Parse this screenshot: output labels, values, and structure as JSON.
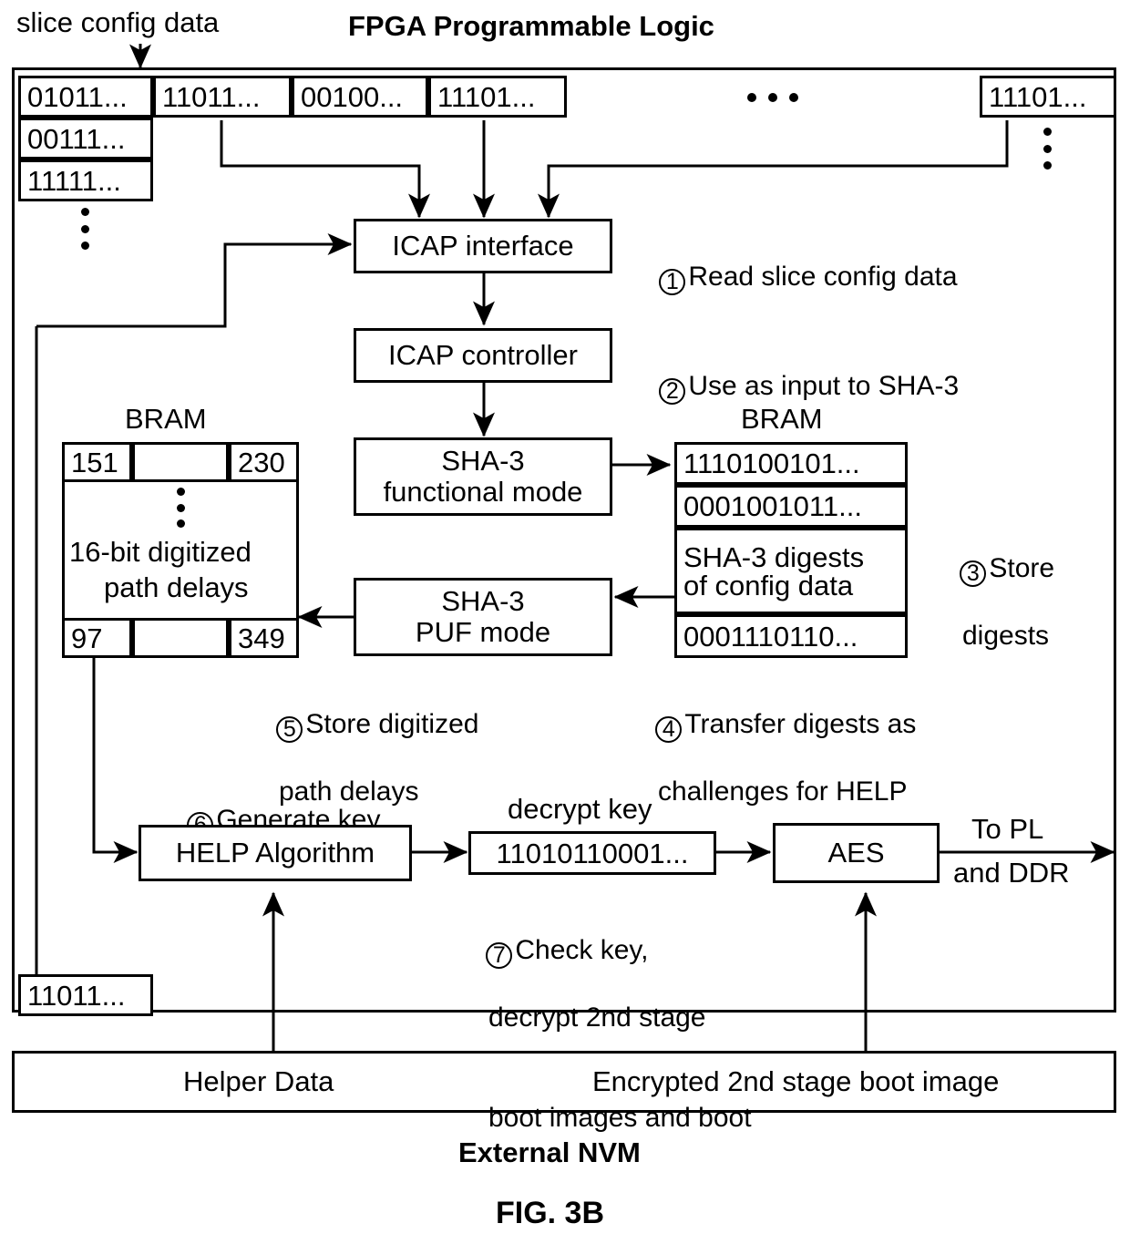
{
  "figure": {
    "caption": "FIG. 3B",
    "top_title": "FPGA Programmable Logic",
    "bottom_title": "External NVM",
    "slice_label": "slice config data"
  },
  "config_rows": {
    "row1": [
      "01011...",
      "11011...",
      "00100...",
      "11101...",
      "11101..."
    ],
    "row2": "00111...",
    "row3": "11111...",
    "ellipsis_mid": "•••"
  },
  "blocks": {
    "icap_interface": "ICAP interface",
    "icap_controller": "ICAP controller",
    "sha3_functional": "SHA-3\nfunctional mode",
    "sha3_functional_l1": "SHA-3",
    "sha3_functional_l2": "functional mode",
    "sha3_puf": "SHA-3\nPUF mode",
    "sha3_puf_l1": "SHA-3",
    "sha3_puf_l2": "PUF mode",
    "help_algorithm": "HELP Algorithm",
    "aes": "AES",
    "decrypt_key_label": "decrypt key",
    "decrypt_key_value": "11010110001...",
    "to_pl_line1": "To PL",
    "to_pl_line2": "and DDR",
    "helper_data": "Helper Data",
    "encrypted_boot": "Encrypted 2nd stage boot image",
    "helper_data_value": "11011..."
  },
  "bram_left": {
    "title": "BRAM",
    "top_left": "151",
    "top_right": "230",
    "middle_l1": "16-bit digitized",
    "middle_l2": "path delays",
    "bottom_left": "97",
    "bottom_right": "349"
  },
  "bram_right": {
    "title": "BRAM",
    "rows": [
      "1110100101...",
      "0001001011...",
      "SHA-3 digests\nof config data",
      "0001110110..."
    ],
    "row3_l1": "SHA-3 digests",
    "row3_l2": "of config data"
  },
  "steps": [
    {
      "num": "1",
      "lines": [
        "Read slice config data"
      ]
    },
    {
      "num": "2",
      "lines": [
        "Use as input to SHA-3"
      ]
    },
    {
      "num": "3",
      "lines": [
        "Store",
        "digests"
      ]
    },
    {
      "num": "4",
      "lines": [
        "Transfer digests as",
        "challenges for HELP"
      ]
    },
    {
      "num": "5",
      "lines": [
        "Store digitized",
        "path delays"
      ]
    },
    {
      "num": "6",
      "lines": [
        "Generate key"
      ]
    },
    {
      "num": "7",
      "lines": [
        "Check key,",
        "decrypt 2nd stage",
        "boot images and boot"
      ]
    }
  ],
  "colors": {
    "stroke": "#000000",
    "background": "#ffffff"
  }
}
